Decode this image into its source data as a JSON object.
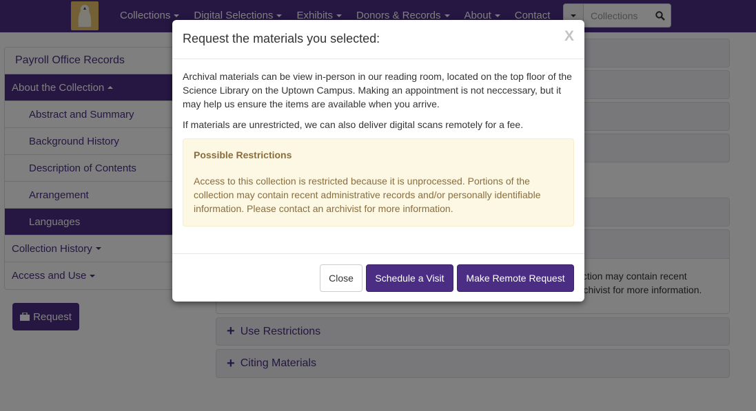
{
  "nav": {
    "logo_icon": "husky-logo-icon",
    "items": [
      {
        "label": "Collections",
        "dropdown": true
      },
      {
        "label": "Digital Selections",
        "dropdown": true
      },
      {
        "label": "Exhibits",
        "dropdown": true
      },
      {
        "label": "Donors & Records",
        "dropdown": true
      },
      {
        "label": "About",
        "dropdown": true
      },
      {
        "label": "Contact",
        "dropdown": false
      }
    ],
    "search": {
      "placeholder": "Collections"
    }
  },
  "sidebar": {
    "title": "Payroll Office Records",
    "about": "About the Collection",
    "sub_items": [
      {
        "label": "Abstract and Summary"
      },
      {
        "label": "Background History"
      },
      {
        "label": "Description of Contents"
      },
      {
        "label": "Arrangement"
      },
      {
        "label": "Languages"
      }
    ],
    "history": "Collection History",
    "access": "Access and Use",
    "request_label": "Request"
  },
  "main": {
    "panel_text_line1": "lection may contain recent",
    "panel_text_line2": "archivist for more information.",
    "use_restrictions": "Use Restrictions",
    "citing_materials": "Citing Materials"
  },
  "modal": {
    "title": "Request the materials you selected:",
    "close_x": "X",
    "para1": "Archival materials can be view in-person in our reading room, located on the top floor of the Science Library on the Uptown Campus. Making an appointment is not neccessary, but it may help us ensure the items are available when you arrive.",
    "para2": "If materials are unrestricted, we can also deliver digital scans remotely for a fee.",
    "alert_title": "Possible Restrictions",
    "alert_text": "Access to this collection is restricted because it is unprocessed. Portions of the collection may contain recent administrative records and/or personally identifiable information. Please contact an archivist for more information.",
    "buttons": {
      "close": "Close",
      "schedule": "Schedule a Visit",
      "remote": "Make Remote Request"
    }
  },
  "colors": {
    "primary": "#4b2e83",
    "alert_bg": "#fcf8e3",
    "alert_text": "#8a6d3b"
  }
}
